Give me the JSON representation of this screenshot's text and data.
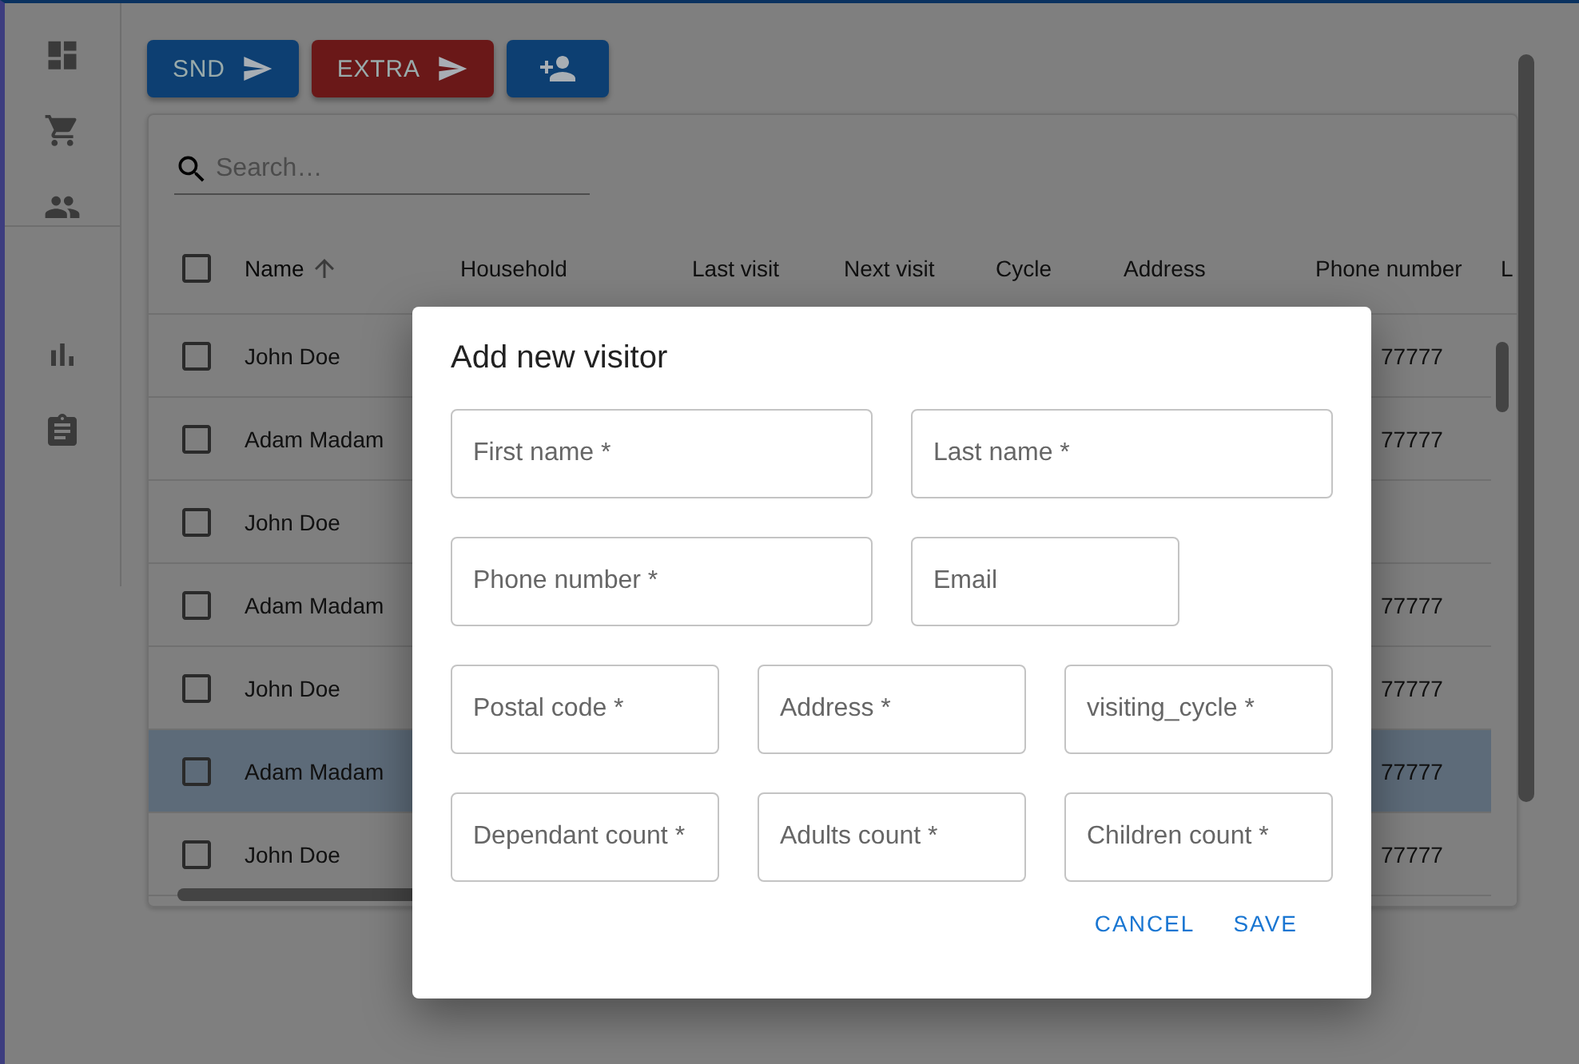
{
  "toolbar": {
    "buttons": [
      {
        "label": "SND",
        "kind": "send",
        "color": "#0d3f72"
      },
      {
        "label": "EXTRA",
        "kind": "send",
        "color": "#6a1818"
      },
      {
        "kind": "add-person",
        "color": "#0d3f72"
      }
    ]
  },
  "table": {
    "all_checked": false,
    "search": {
      "placeholder": "Search…"
    },
    "columns": [
      {
        "label": "Name",
        "sorted": true
      },
      {
        "label": "Household"
      },
      {
        "label": "Last visit"
      },
      {
        "label": "Next visit"
      },
      {
        "label": "Cycle"
      },
      {
        "label": "Address"
      },
      {
        "label": "Phone number"
      },
      {
        "label": "L"
      }
    ],
    "rows": [
      {
        "name": "John Doe",
        "phone": "77777",
        "checked": false,
        "selected": false
      },
      {
        "name": "Adam Madam",
        "phone": "77777",
        "checked": false,
        "selected": false
      },
      {
        "name": "John Doe",
        "checked": false,
        "selected": false
      },
      {
        "name": "Adam Madam",
        "phone": "77777",
        "checked": false,
        "selected": false
      },
      {
        "name": "John Doe",
        "phone": "77777",
        "checked": false,
        "selected": false
      },
      {
        "name": "Adam Madam",
        "phone": "77777",
        "checked": false,
        "selected": true
      },
      {
        "name": "John Doe",
        "phone": "77777",
        "checked": false,
        "selected": false
      }
    ]
  },
  "dialog": {
    "title": "Add new visitor",
    "field_rows": [
      [
        {
          "placeholder": "First name *"
        },
        {
          "placeholder": "Last name *"
        }
      ],
      [
        {
          "placeholder": "Phone number *"
        },
        {
          "placeholder": "Email"
        }
      ],
      [
        {
          "placeholder": "Postal code *"
        },
        {
          "placeholder": "Address *"
        },
        {
          "placeholder": "visiting_cycle *"
        }
      ],
      [
        {
          "placeholder": "Dependant count *"
        },
        {
          "placeholder": "Adults count *"
        },
        {
          "placeholder": "Children count *"
        }
      ]
    ],
    "actions": [
      "CANCEL",
      "SAVE"
    ]
  }
}
